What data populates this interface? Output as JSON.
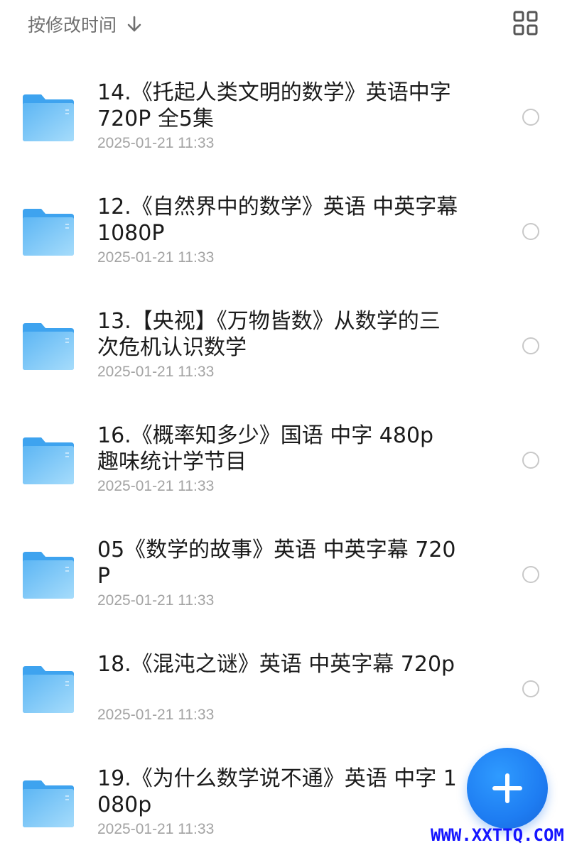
{
  "header": {
    "sort_label": "按修改时间",
    "sort_icon": "arrow-down-icon",
    "view_icon": "grid-view-icon"
  },
  "items": [
    {
      "title": "14.《托起人类文明的数学》英语中字 720P 全5集",
      "date": "2025-01-21 11:33"
    },
    {
      "title": "12.《自然界中的数学》英语 中英字幕 1080P",
      "date": "2025-01-21 11:33"
    },
    {
      "title": "13.【央视】《万物皆数》从数学的三次危机认识数学",
      "date": "2025-01-21 11:33"
    },
    {
      "title": "16.《概率知多少》国语 中字 480p 趣味统计学节目",
      "date": "2025-01-21 11:33"
    },
    {
      "title": "05《数学的故事》英语 中英字幕 720P",
      "date": "2025-01-21 11:33"
    },
    {
      "title": "18.《混沌之谜》英语 中英字幕 720p",
      "date": "2025-01-21 11:33"
    },
    {
      "title": "19.《为什么数学说不通》英语 中字 1080p",
      "date": "2025-01-21 11:33"
    }
  ],
  "fab": {
    "icon": "plus-icon"
  },
  "watermark": "WWW.XXTTQ.COM",
  "colors": {
    "folder_front": "#7cc6f7",
    "folder_back": "#3ea3ef",
    "fab": "#1e7df2",
    "watermark": "#1515ff"
  }
}
